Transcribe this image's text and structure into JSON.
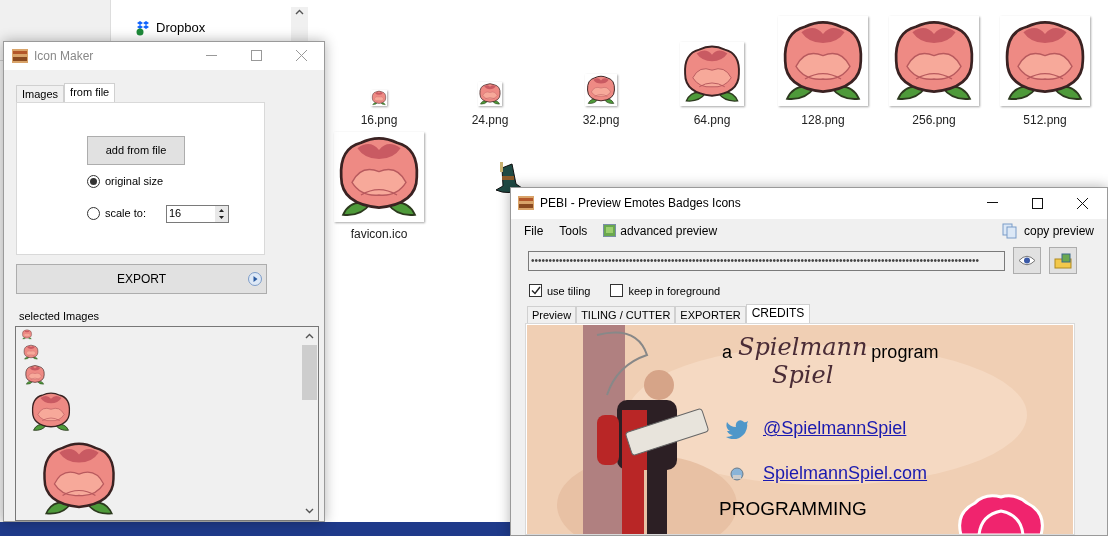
{
  "explorer": {
    "nav_items": [
      {
        "label": "Dropbox"
      }
    ],
    "files": [
      {
        "name": "16.png"
      },
      {
        "name": "24.png"
      },
      {
        "name": "32.png"
      },
      {
        "name": "64.png"
      },
      {
        "name": "128.png"
      },
      {
        "name": "256.png"
      },
      {
        "name": "512.png"
      },
      {
        "name": "favicon.ico"
      }
    ]
  },
  "icon_maker": {
    "title": "Icon Maker",
    "tabs": [
      {
        "label": "Images",
        "selected": false
      },
      {
        "label": "from file",
        "selected": true
      }
    ],
    "add_button": "add from file",
    "radios": [
      {
        "label": "original size",
        "selected": true
      },
      {
        "label": "scale to:",
        "selected": false
      }
    ],
    "scale_value": "16",
    "export_button": "EXPORT",
    "list_label": "selected Images"
  },
  "pebi": {
    "title": "PEBI - Preview Emotes Badges Icons",
    "menu": [
      {
        "label": "File"
      },
      {
        "label": "Tools"
      },
      {
        "label": "advanced preview"
      }
    ],
    "copy_preview": "copy preview",
    "path_value": "••••••••••••••••••••••••••••••••••••••••••••••••••••••••••••••••••••••••••••••••••••••••••••••••••••••••••••••••••••••••••••••••",
    "checkboxes": [
      {
        "label": "use tiling",
        "checked": true
      },
      {
        "label": "keep in foreground",
        "checked": false
      }
    ],
    "tabs": [
      {
        "label": "Preview",
        "selected": false
      },
      {
        "label": "TILING / CUTTER",
        "selected": false
      },
      {
        "label": "EXPORTER",
        "selected": false
      },
      {
        "label": "CREDITS",
        "selected": true
      }
    ],
    "credits": {
      "prefix": "a",
      "logo_top": "Spielmann",
      "logo_bottom": "Spiel",
      "suffix": "program",
      "twitter": "@SpielmannSpiel",
      "website": "SpielmannSpiel.com",
      "heading": "PROGRAMMING"
    }
  }
}
